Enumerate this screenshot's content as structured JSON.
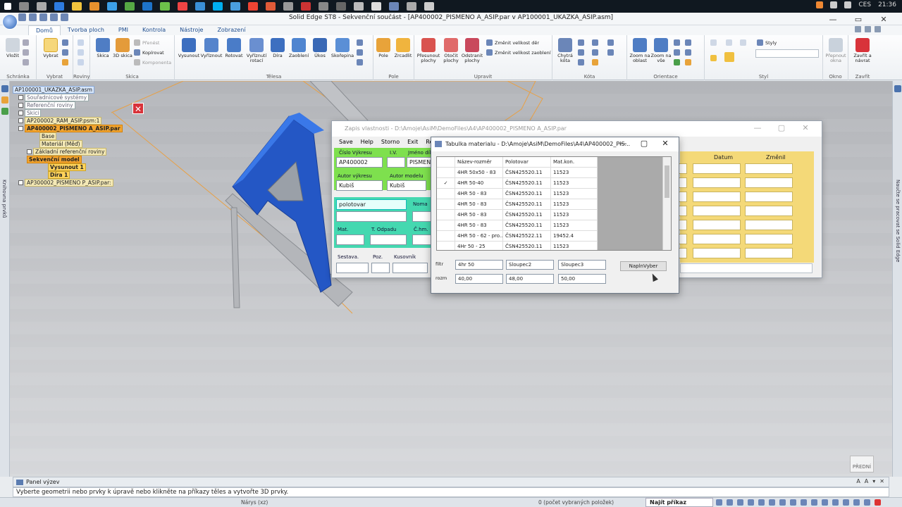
{
  "taskbar": {
    "language": "CES",
    "time": "21:36"
  },
  "app": {
    "title": "Solid Edge ST8 - Sekvenční součást - [AP400002_PISMENO A_ASIP.par v AP100001_UKAZKA_ASIP.asm]"
  },
  "ribbon_tabs": [
    "Domů",
    "Tvorba ploch",
    "PMI",
    "Kontrola",
    "Nástroje",
    "Zobrazení"
  ],
  "ribbon": {
    "groups": {
      "schranka": "Schránka",
      "vybrat": "Vybrat",
      "roviny": "Roviny",
      "skica": "Skica",
      "telesa": "Tělesa",
      "pole": "Pole",
      "upravit": "Upravit",
      "kota": "Kóta",
      "orientace": "Orientace",
      "styl": "Styl",
      "okno": "Okno",
      "zavrit": "Zavřít"
    },
    "buttons": {
      "vlozit": "Vložit",
      "vybrat": "Vybrat",
      "skica": "Skica",
      "skica3d": "3D skica",
      "prenest": "Přenést",
      "kopirovat": "Kopírovat",
      "komponenta": "Komponenta",
      "vysunout": "Vysunout",
      "vyriznout": "Vyříznout",
      "rotovat": "Rotovat",
      "vyriznuti_rotaci": "Vyříznutí rotací",
      "dira": "Díra",
      "zaobleni": "Zaoblení",
      "ukos": "Úkos",
      "skorepina": "Skořepina",
      "pole": "Pole",
      "zrcadlit": "Zrcadlit",
      "presunout": "Přesunout plochy",
      "otocit": "Otočit plochy",
      "odstranit": "Odstranit plochy",
      "zmenit_der": "Změnit velikost děr",
      "zmenit_zaobleni": "Změnit velikost zaoblení",
      "chytra_kota": "Chytrá kóta",
      "zoom_oblast": "Zoom na oblast",
      "zoom_vse": "Zoom na vše",
      "styly": "Styly",
      "prepnout_okna": "Přepnout okna",
      "zavrit_navrat": "Zavřít a návrat"
    }
  },
  "tree": {
    "items": [
      "AP100001_UKAZKA_ASIP.asm",
      "Souřadnicové systémy",
      "Referenční roviny",
      "Skici",
      "AP200002_RAM_ASIP.psm:1",
      "AP400002_PISMENO A_ASIP.par",
      "Base",
      "Materiál (Měď)",
      "Základní referenční roviny",
      "Sekvenční model",
      "Vysunout 1",
      "Díra 1",
      "AP300002_PISMENO P_ASIP.par:"
    ]
  },
  "left_strip_label": "Knihovna prvků",
  "right_strip_label": "Naučte se pracovat se Solid Edge",
  "zapis_window": {
    "title": "Zapis vlastnosti - D:\\Amoje\\AsiM\\DemoFiles\\A4\\AP400002_PISMENO A_ASIP.par",
    "menu": [
      "Save",
      "Help",
      "Storno",
      "Exit",
      "Re"
    ],
    "labels": {
      "cislo_vykresu": "Číslo Výkresu",
      "iv": "I.V.",
      "jmeno_dilu": "Jméno díl",
      "autor_vykresu": "Autor výkresu",
      "autor_modelu": "Autor modelu",
      "noma": "Noma",
      "mat": "Mat.",
      "t_odpadu": "T. Odpadu",
      "c_hm": "Č.hm.",
      "sestava": "Sestava.",
      "poz": "Poz.",
      "kusovnik": "Kusovník",
      "datum": "Datum",
      "zmenil": "Změnil"
    },
    "values": {
      "cislo_vykresu": "AP400002",
      "jmeno_dilu": "PISMEN",
      "autor_vykresu": "Kubiš",
      "autor_modelu": "Kubiš",
      "polotovar": "polotovar"
    }
  },
  "tabulka_window": {
    "title": "Tabulka materialu - D:\\Amoje\\AsiM\\DemoFiles\\A4\\AP400002_PIS...",
    "columns": [
      "Název-rozměr",
      "Polotovar",
      "Mat.kon."
    ],
    "rows": [
      {
        "sel": "",
        "nazev": "4HR 50x50 - 83",
        "polotovar": "ČSN425520.11",
        "mat": "11523"
      },
      {
        "sel": "✓",
        "nazev": "4HR 50-40",
        "polotovar": "ČSN425520.11",
        "mat": "11523"
      },
      {
        "sel": "",
        "nazev": "4HR 50 - 83",
        "polotovar": "ČSN425520.11",
        "mat": "11523"
      },
      {
        "sel": "",
        "nazev": "4HR 50 - 83",
        "polotovar": "ČSN425520.11",
        "mat": "11523"
      },
      {
        "sel": "",
        "nazev": "4HR 50 - 83",
        "polotovar": "ČSN425520.11",
        "mat": "11523"
      },
      {
        "sel": "",
        "nazev": "4HR 50 - 83",
        "polotovar": "ČSN425520.11",
        "mat": "11523"
      },
      {
        "sel": "",
        "nazev": "4HR 50 - 62 - pro...",
        "polotovar": "ČSN425522.11",
        "mat": "19452.4"
      },
      {
        "sel": "",
        "nazev": "4Hr 50 - 25",
        "polotovar": "ČSN425520.11",
        "mat": "11523"
      }
    ],
    "filter_label": "filtr",
    "rozm_label": "rozm",
    "filters": [
      "4hr 50",
      "Sloupec2",
      "Sloupec3"
    ],
    "rozm": [
      "40,00",
      "48,00",
      "50,00"
    ],
    "button": "NaplnVyber"
  },
  "orientation_label": "PŘEDNÍ",
  "panel_vyzev": "Panel výzev",
  "prompt": "Vyberte geometrii nebo prvky k úpravě nebo klikněte na příkazy těles a vytvořte 3D prvky.",
  "status": {
    "view": "Nárys (xz)",
    "selected": "0 (počet vybraných položek)",
    "command": "Najít příkaz"
  }
}
